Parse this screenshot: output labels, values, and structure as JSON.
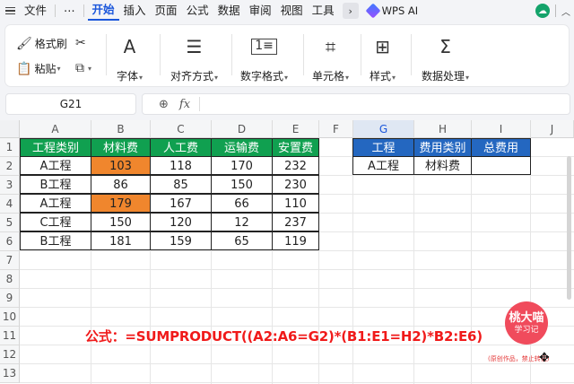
{
  "menu": {
    "file": "文件",
    "items": [
      "开始",
      "插入",
      "页面",
      "公式",
      "数据",
      "审阅",
      "视图",
      "工具"
    ],
    "active": "开始",
    "wps_ai": "WPS AI"
  },
  "ribbon": {
    "format_painter": "格式刷",
    "paste": "粘贴",
    "font": "字体",
    "align": "对齐方式",
    "number_format": "数字格式",
    "cell": "单元格",
    "style": "样式",
    "data_process": "数据处理"
  },
  "formula_bar": {
    "cell_ref": "G21",
    "fx": "fx",
    "content": ""
  },
  "grid": {
    "columns": [
      "A",
      "B",
      "C",
      "D",
      "E",
      "F",
      "G",
      "H",
      "I",
      "J"
    ],
    "rows": [
      "1",
      "2",
      "3",
      "4",
      "5",
      "6",
      "7",
      "8",
      "9",
      "10",
      "11",
      "12",
      "13"
    ],
    "selected_column": "G"
  },
  "table1": {
    "headers": [
      "工程类别",
      "材料费",
      "人工费",
      "运输费",
      "安置费"
    ],
    "rows": [
      [
        "A工程",
        "103",
        "118",
        "170",
        "232"
      ],
      [
        "B工程",
        "86",
        "85",
        "150",
        "230"
      ],
      [
        "A工程",
        "179",
        "167",
        "66",
        "110"
      ],
      [
        "C工程",
        "150",
        "120",
        "12",
        "237"
      ],
      [
        "B工程",
        "181",
        "159",
        "65",
        "119"
      ]
    ],
    "highlight_color": "#f0862d",
    "header_color": "#10a050"
  },
  "table2": {
    "headers": [
      "工程",
      "费用类别",
      "总费用"
    ],
    "row": [
      "A工程",
      "材料费",
      ""
    ],
    "header_color": "#2467c0"
  },
  "formula_text": "公式：=SUMPRODUCT((A2:A6=G2)*(B1:E1=H2)*B2:E6)",
  "watermark": {
    "line1": "桃大喵",
    "line2": "学习记",
    "note": "(原创作品，禁止转载)"
  }
}
